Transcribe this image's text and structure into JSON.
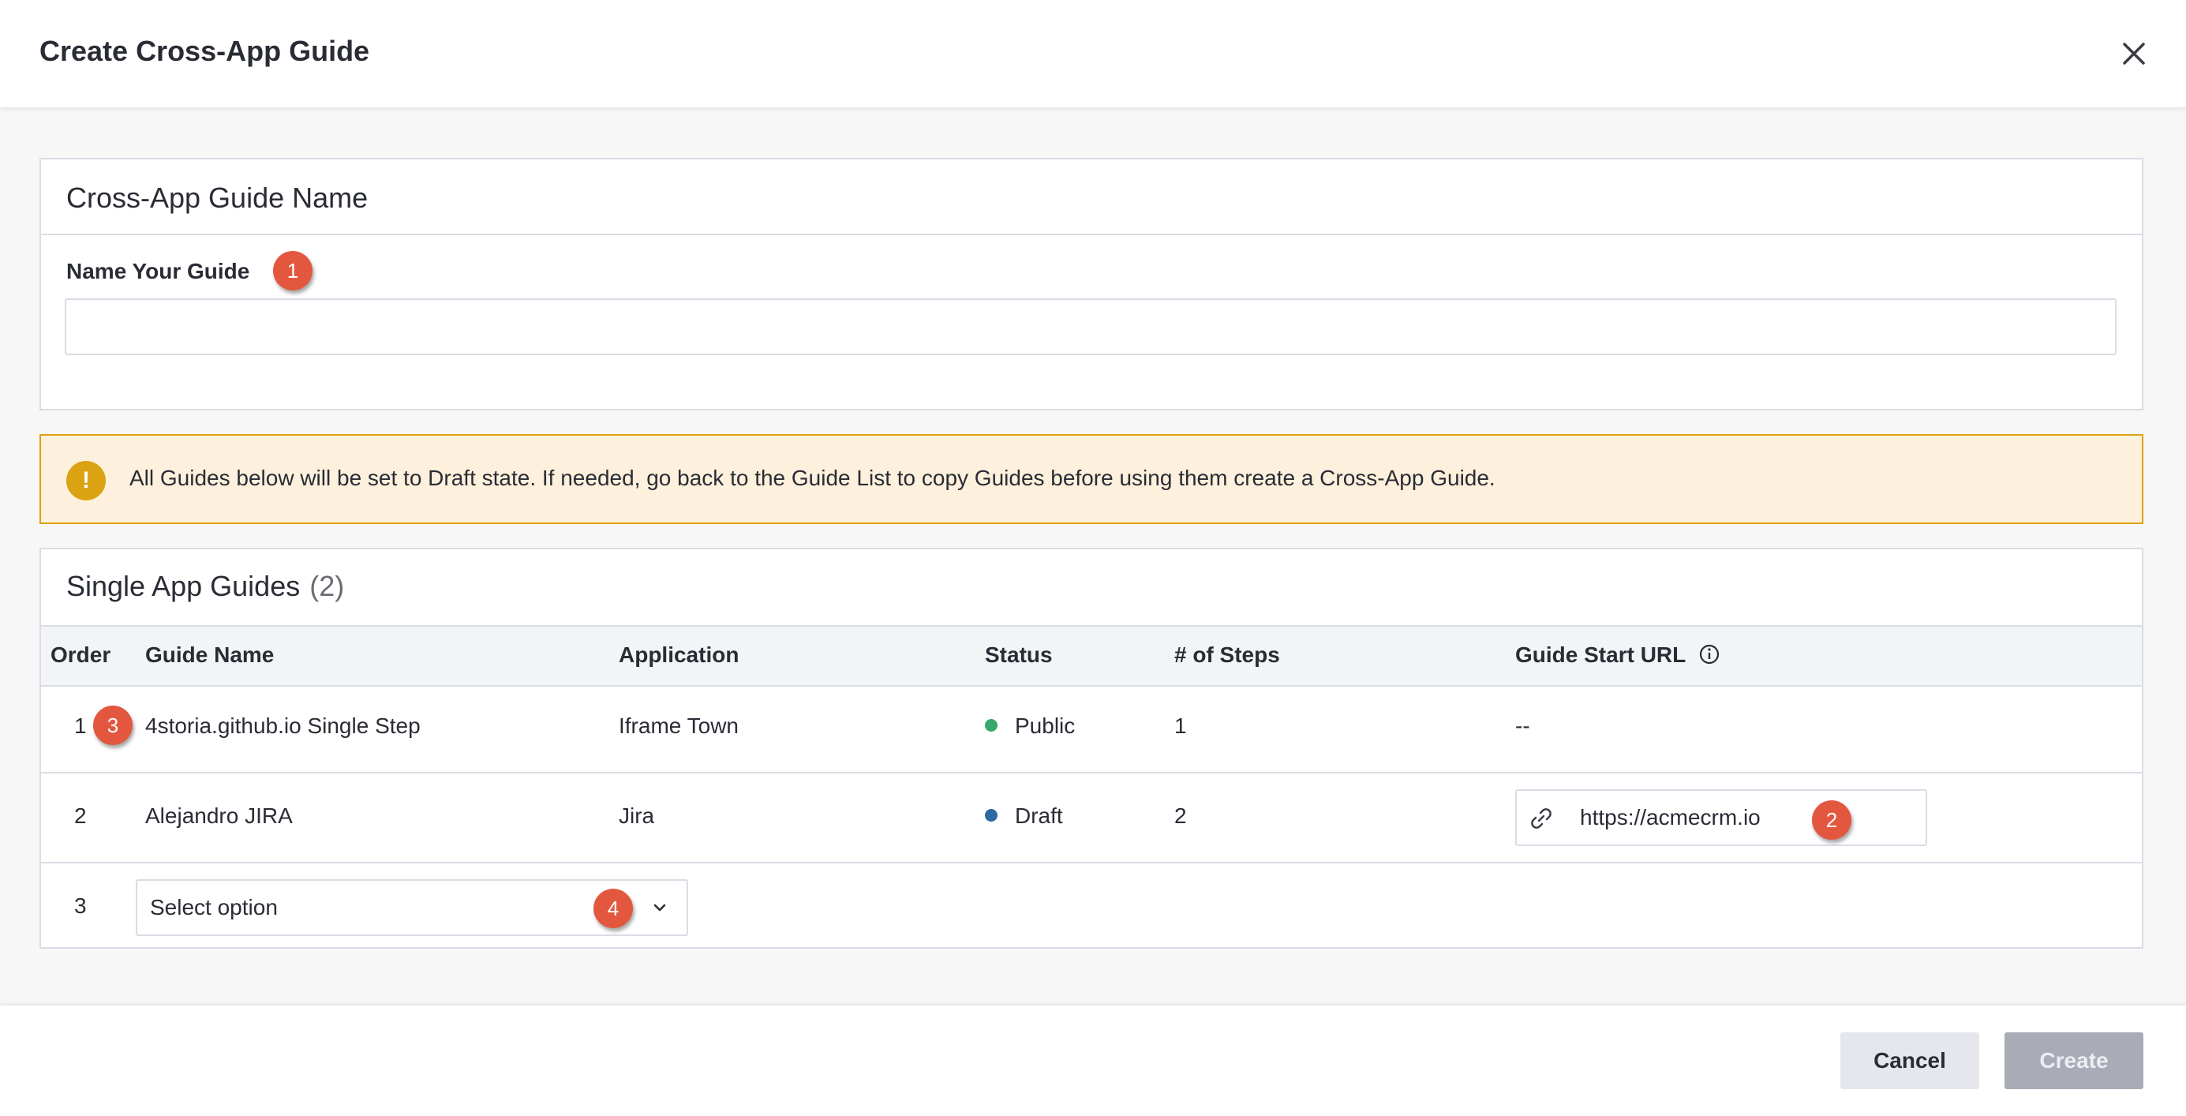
{
  "header": {
    "title": "Create Cross-App Guide"
  },
  "name_panel": {
    "title": "Cross-App Guide Name",
    "field_label": "Name Your Guide",
    "input_value": "",
    "input_placeholder": ""
  },
  "alert": {
    "icon": "!",
    "text": "All Guides below will be set to Draft state. If needed, go back to the Guide List to copy Guides before using them create a Cross-App Guide."
  },
  "guides": {
    "title": "Single App Guides",
    "count": "(2)",
    "columns": [
      "Order",
      "Guide Name",
      "Application",
      "Status",
      "# of Steps",
      "Guide Start URL"
    ],
    "rows": [
      {
        "order": "1",
        "name": "4storia.github.io Single Step",
        "application": "Iframe Town",
        "status": "Public",
        "status_color": "#3aa76d",
        "steps": "1",
        "start_url": "--"
      },
      {
        "order": "2",
        "name": "Alejandro JIRA",
        "application": "Jira",
        "status": "Draft",
        "status_color": "#2d6aa3",
        "steps": "2",
        "start_url": "https://acmecrm.io"
      }
    ],
    "new_row": {
      "order": "3",
      "select_value": "Select option"
    }
  },
  "badges": [
    "1",
    "2",
    "3",
    "4"
  ],
  "footer": {
    "cancel_label": "Cancel",
    "create_label": "Create"
  },
  "colors": {
    "badge": "#e3573f",
    "alert_bg": "#fdf0dc",
    "alert_border": "#dba211",
    "create_disabled": "#a9acb6"
  }
}
